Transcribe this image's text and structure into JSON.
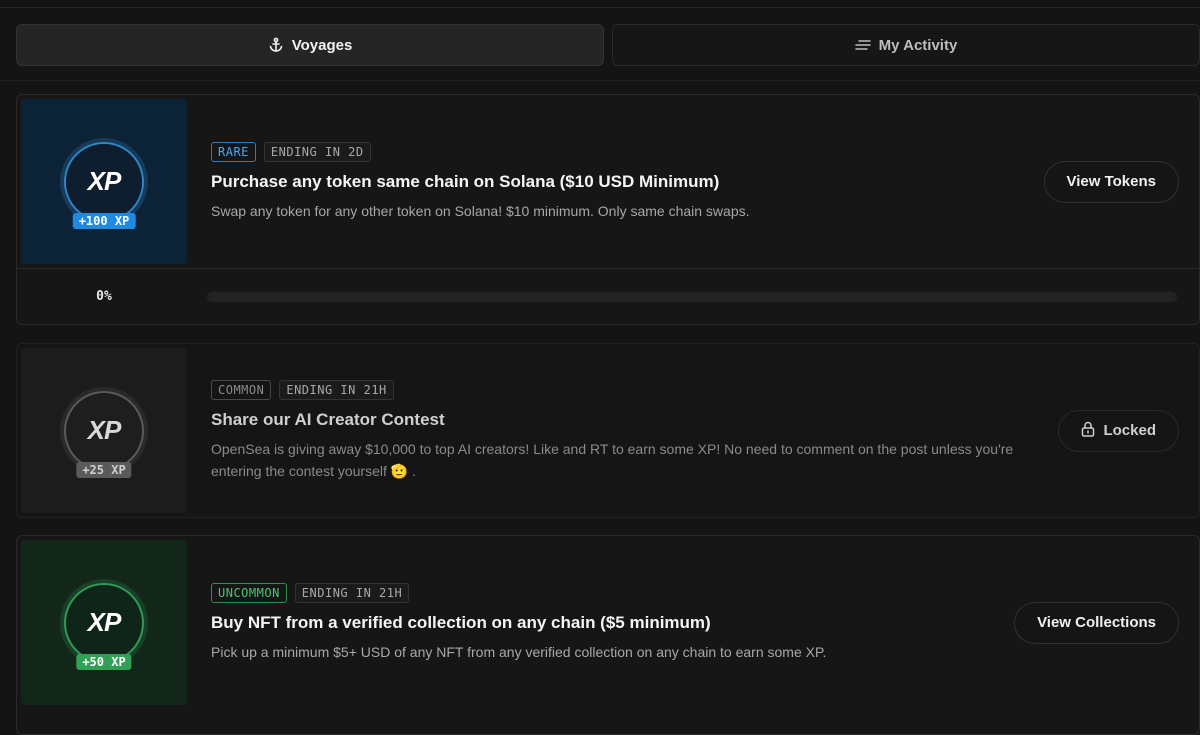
{
  "tabs": [
    {
      "label": "Voyages",
      "icon": "anchor-icon",
      "active": true
    },
    {
      "label": "My Activity",
      "icon": "list-icon",
      "active": false
    }
  ],
  "quests": [
    {
      "rarity": "RARE",
      "ending": "ENDING IN 2D",
      "xp": "+100 XP",
      "title": "Purchase any token same chain on Solana ($10 USD Minimum)",
      "description": "Swap any token for any other token on Solana! $10 minimum. Only same chain swaps.",
      "action": "View Tokens",
      "progress_label": "0%",
      "progress": 0
    },
    {
      "rarity": "COMMON",
      "ending": "ENDING IN 21H",
      "xp": "+25 XP",
      "title": "Share our AI Creator Contest",
      "description": "OpenSea is giving away $10,000 to top AI creators! Like and RT to earn some XP! No need to comment on the post unless you're entering the contest yourself 🫡 .",
      "action": "Locked",
      "action_icon": "lock-icon"
    },
    {
      "rarity": "UNCOMMON",
      "ending": "ENDING IN 21H",
      "xp": "+50 XP",
      "title": "Buy NFT from a verified collection on any chain ($5 minimum)",
      "description": "Pick up a minimum $5+ USD of any NFT from any verified collection on any chain to earn some XP.",
      "action": "View Collections"
    }
  ],
  "badge_text": "XP",
  "colors": {
    "rare": "#1f8ae0",
    "common": "#5a5a5a",
    "uncommon": "#2fa055",
    "background": "#141414"
  }
}
